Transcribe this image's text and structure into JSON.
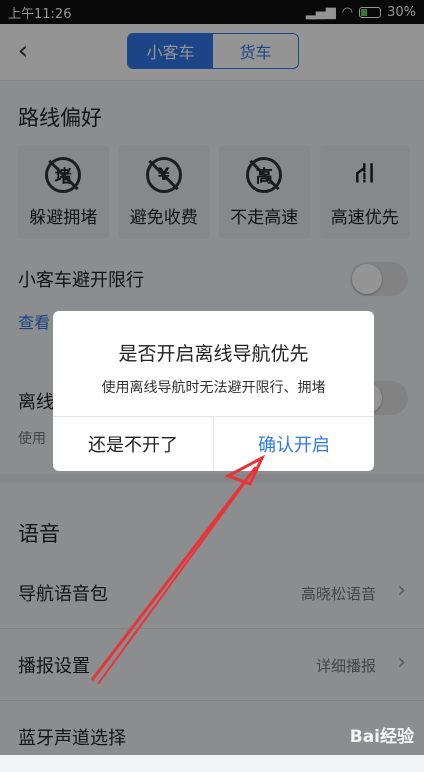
{
  "status_bar": {
    "time": "上午11:26",
    "battery": "30%"
  },
  "header": {
    "tabs": [
      "小客车",
      "货车"
    ],
    "active_tab": "小客车"
  },
  "route_preference": {
    "title": "路线偏好",
    "options": [
      {
        "label": "躲避拥堵",
        "icon_char": "堵",
        "icon": "avoid-congestion-icon"
      },
      {
        "label": "避免收费",
        "icon_char": "¥",
        "icon": "avoid-toll-icon"
      },
      {
        "label": "不走高速",
        "icon_char": "高",
        "icon": "no-highway-icon"
      },
      {
        "label": "高速优先",
        "icon_char": "⛙",
        "icon": "highway-first-icon"
      }
    ]
  },
  "restriction": {
    "label": "小客车避开限行",
    "link_partial": "查看"
  },
  "offline": {
    "label_partial": "离线",
    "sub_partial": "使用"
  },
  "voice": {
    "title": "语音",
    "items": [
      {
        "label": "导航语音包",
        "value": "高晓松语音"
      },
      {
        "label": "播报设置",
        "value": "详细播报"
      },
      {
        "label": "蓝牙声道选择",
        "value": ""
      }
    ]
  },
  "dialog": {
    "title": "是否开启离线导航优先",
    "message": "使用离线导航时无法避开限行、拥堵",
    "cancel": "还是不开了",
    "confirm": "确认开启"
  },
  "watermark": "Bai经验"
}
